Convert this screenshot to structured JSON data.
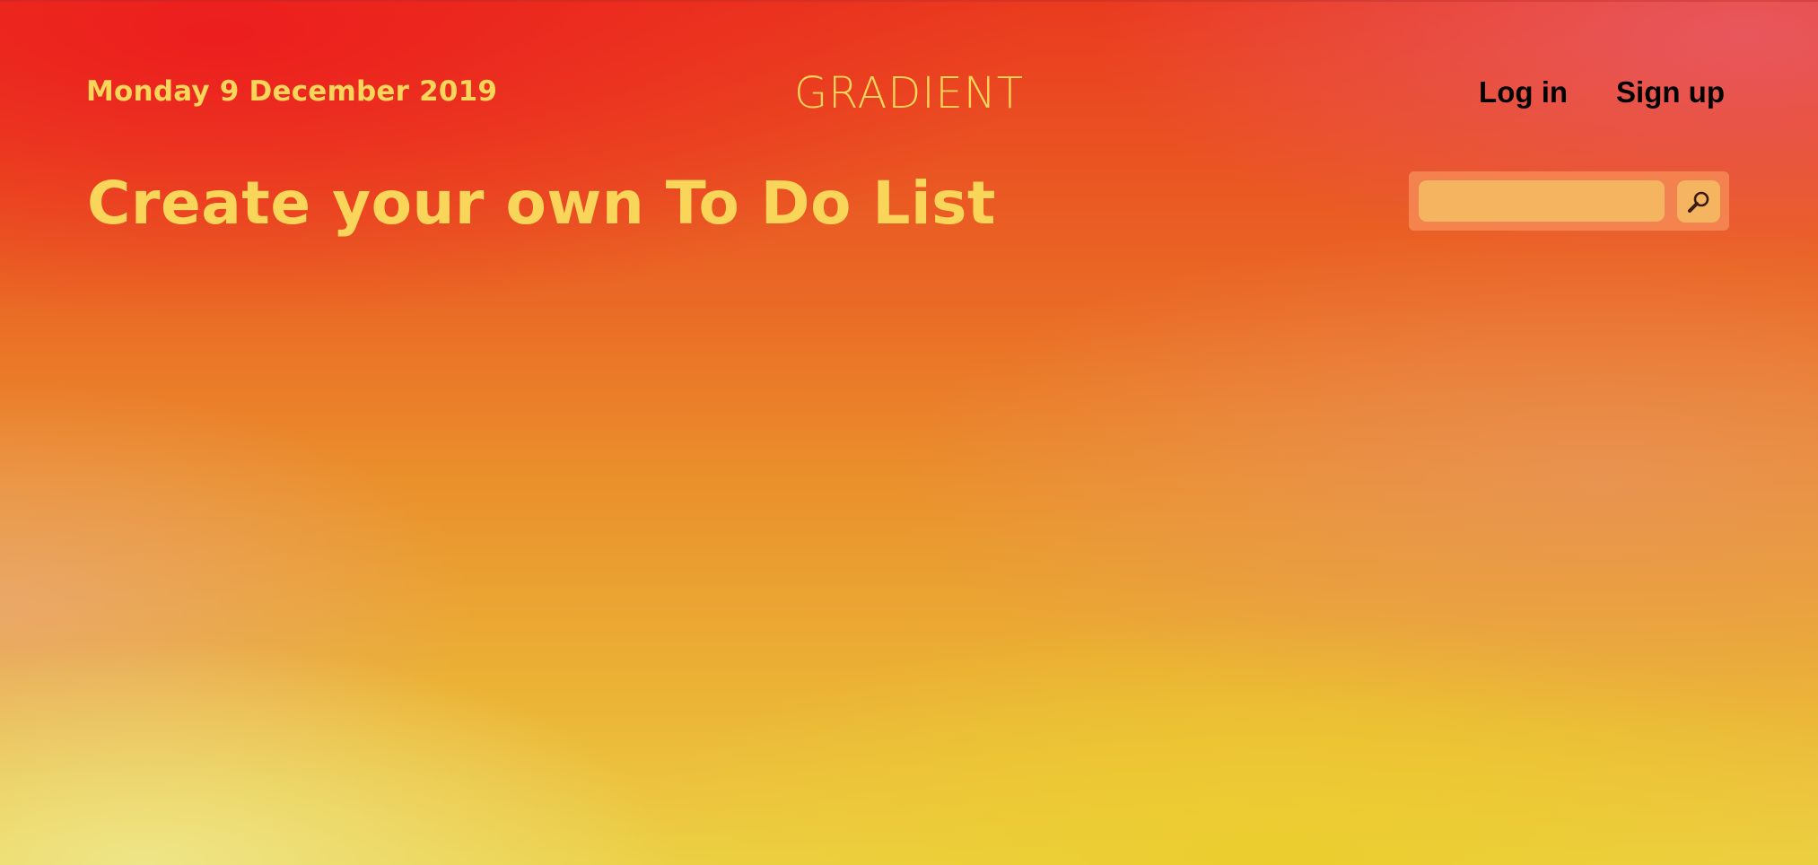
{
  "header": {
    "date": "Monday 9 December 2019",
    "brand": "GRADIENT",
    "nav": {
      "login_label": "Log in",
      "signup_label": "Sign up"
    }
  },
  "main": {
    "headline": "Create your own To Do List"
  },
  "search": {
    "value": "",
    "placeholder": "",
    "button_icon": "search-icon"
  },
  "colors": {
    "accent_text": "#f9d55a",
    "nav_text": "#000000",
    "search_field": "#f5b460"
  }
}
